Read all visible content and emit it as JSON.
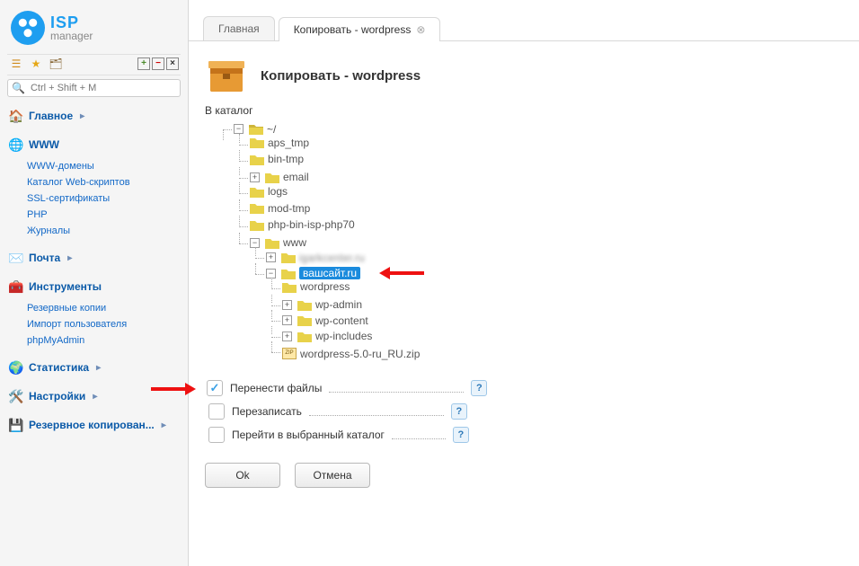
{
  "brand": {
    "top": "ISP",
    "bottom": "manager"
  },
  "search": {
    "placeholder": "Ctrl + Shift + M"
  },
  "tabs": [
    {
      "label": "Главная"
    },
    {
      "label": "Копировать - wordpress"
    }
  ],
  "panel": {
    "title": "Копировать - wordpress",
    "catalog_label": "В каталог"
  },
  "tree": {
    "root": "~/",
    "items": {
      "aps_tmp": "aps_tmp",
      "bin_tmp": "bin-tmp",
      "email": "email",
      "logs": "logs",
      "mod_tmp": "mod-tmp",
      "php_bin": "php-bin-isp-php70",
      "www": "www",
      "blurred_site": "igarkcenter.ru",
      "yoursite": "вашсайт.ru",
      "wordpress": "wordpress",
      "wp_admin": "wp-admin",
      "wp_content": "wp-content",
      "wp_includes": "wp-includes",
      "wp_zip": "wordpress-5.0-ru_RU.zip"
    }
  },
  "opts": {
    "move": "Перенести файлы",
    "overwrite": "Перезаписать",
    "go": "Перейти в выбранный каталог"
  },
  "btns": {
    "ok": "Ok",
    "cancel": "Отмена"
  },
  "nav": {
    "main": "Главное",
    "www": "WWW",
    "www_children": {
      "domains": "WWW-домены",
      "scripts": "Каталог Web-скриптов",
      "ssl": "SSL-сертификаты",
      "php": "PHP",
      "logs": "Журналы"
    },
    "mail": "Почта",
    "tools": "Инструменты",
    "tools_children": {
      "backup": "Резервные копии",
      "import": "Импорт пользователя",
      "pma": "phpMyAdmin"
    },
    "stats": "Статистика",
    "settings": "Настройки",
    "backup": "Резервное копирован..."
  }
}
